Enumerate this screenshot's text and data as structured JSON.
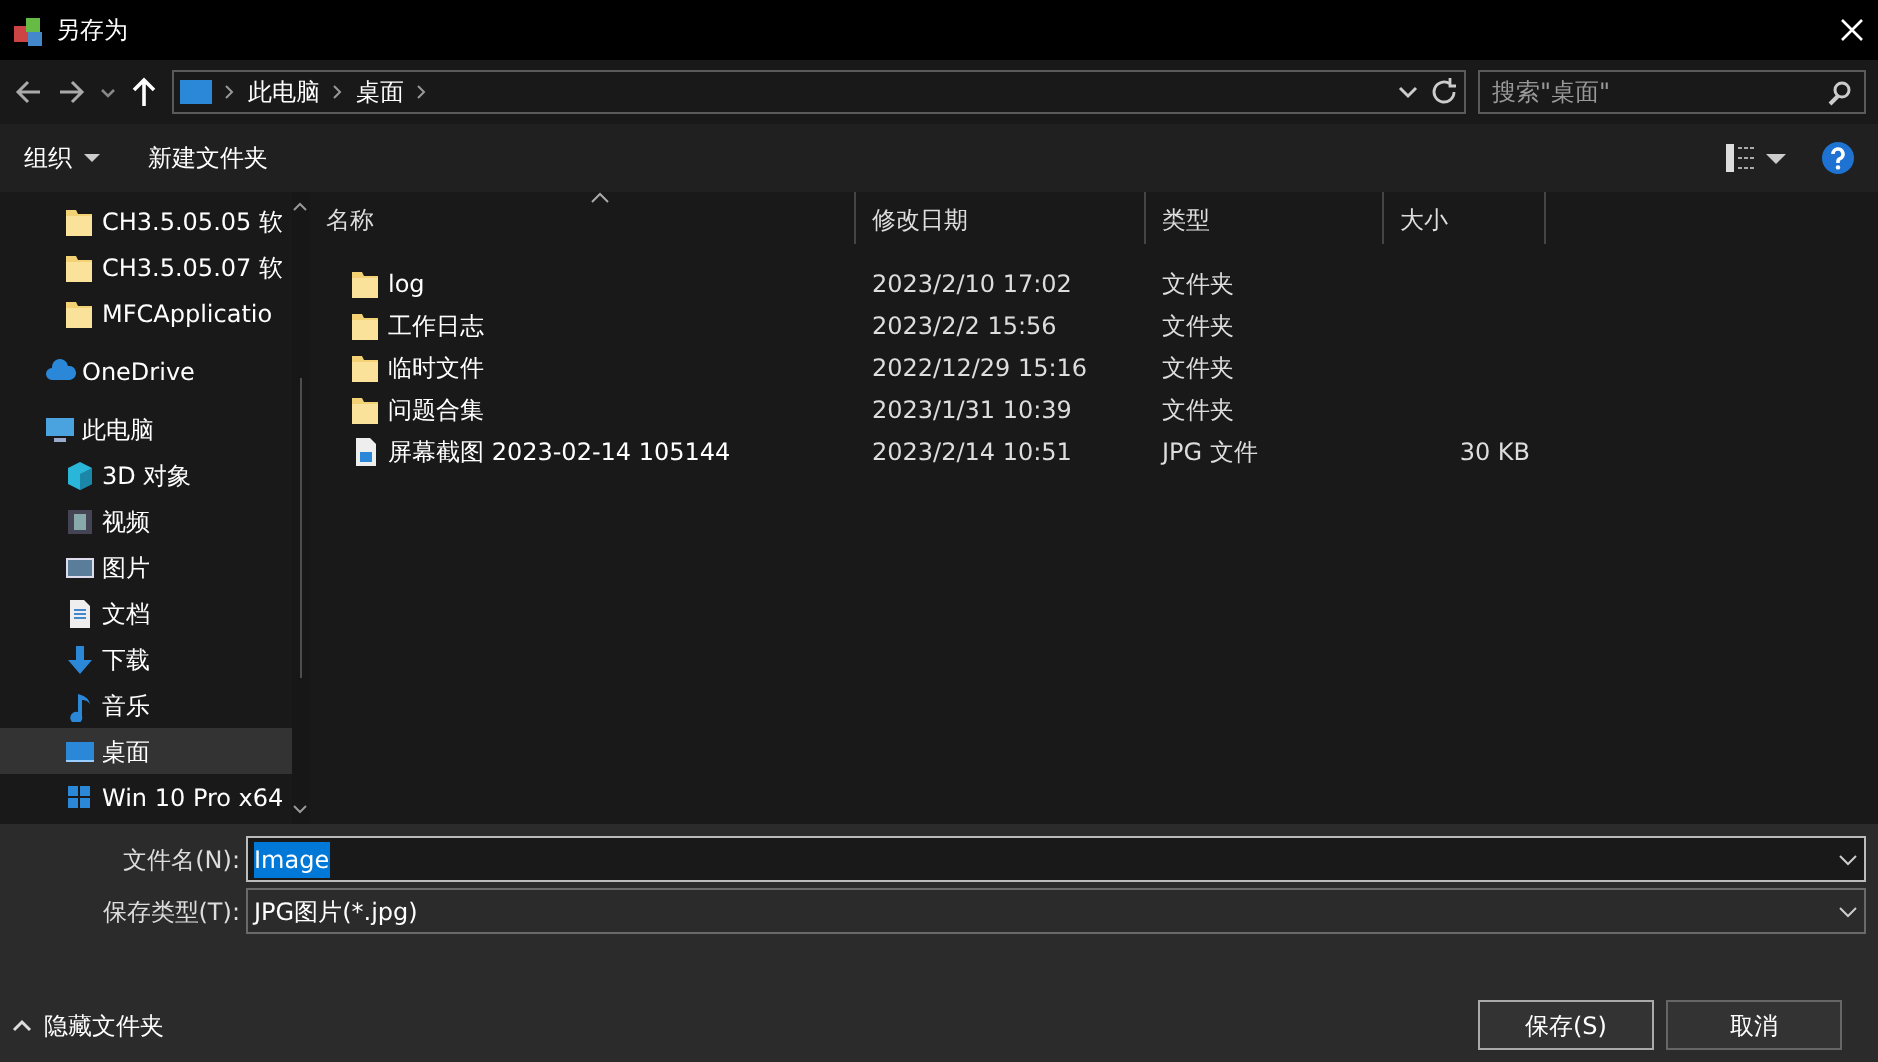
{
  "window": {
    "title": "另存为"
  },
  "address_bar": {
    "crumbs": [
      "此电脑",
      "桌面"
    ]
  },
  "search": {
    "placeholder": "搜索\"桌面\""
  },
  "toolbar": {
    "organize": "组织",
    "new_folder": "新建文件夹"
  },
  "sidebar": {
    "items": [
      {
        "label": "CH3.5.05.05 软",
        "kind": "folder",
        "selected": false
      },
      {
        "label": "CH3.5.05.07 软",
        "kind": "folder",
        "selected": false
      },
      {
        "label": "MFCApplicatio",
        "kind": "folder",
        "selected": false
      },
      {
        "label": "OneDrive",
        "kind": "cloud",
        "selected": false
      },
      {
        "label": "此电脑",
        "kind": "pc",
        "selected": false,
        "children": [
          {
            "label": "3D 对象",
            "kind": "cube",
            "selected": false
          },
          {
            "label": "视频",
            "kind": "video",
            "selected": false
          },
          {
            "label": "图片",
            "kind": "picture",
            "selected": false
          },
          {
            "label": "文档",
            "kind": "document",
            "selected": false
          },
          {
            "label": "下载",
            "kind": "download",
            "selected": false
          },
          {
            "label": "音乐",
            "kind": "music",
            "selected": false
          },
          {
            "label": "桌面",
            "kind": "desktop",
            "selected": true
          },
          {
            "label": "Win 10 Pro x64",
            "kind": "drive",
            "selected": false
          }
        ]
      }
    ]
  },
  "table": {
    "columns": [
      "名称",
      "修改日期",
      "类型",
      "大小"
    ],
    "rows": [
      {
        "kind": "folder",
        "name": "log",
        "modified": "2023/2/10 17:02",
        "type": "文件夹"
      },
      {
        "kind": "folder",
        "name": "工作日志",
        "modified": "2023/2/2 15:56",
        "type": "文件夹"
      },
      {
        "kind": "folder",
        "name": "临时文件",
        "modified": "2022/12/29 15:16",
        "type": "文件夹"
      },
      {
        "kind": "folder",
        "name": "问题合集",
        "modified": "2023/1/31 10:39",
        "type": "文件夹"
      },
      {
        "kind": "image",
        "name": "屏幕截图 2023-02-14 105144",
        "modified": "2023/2/14 10:51",
        "type": "JPG 文件",
        "size": "30 KB"
      }
    ]
  },
  "form": {
    "filename_label": "文件名(N):",
    "filename": "Image",
    "filename_selected": true,
    "type_label": "保存类型(T):",
    "type": "JPG图片(*.jpg)"
  },
  "footer": {
    "hide_folders": "隐藏文件夹",
    "save": "保存(S)",
    "cancel": "取消"
  }
}
